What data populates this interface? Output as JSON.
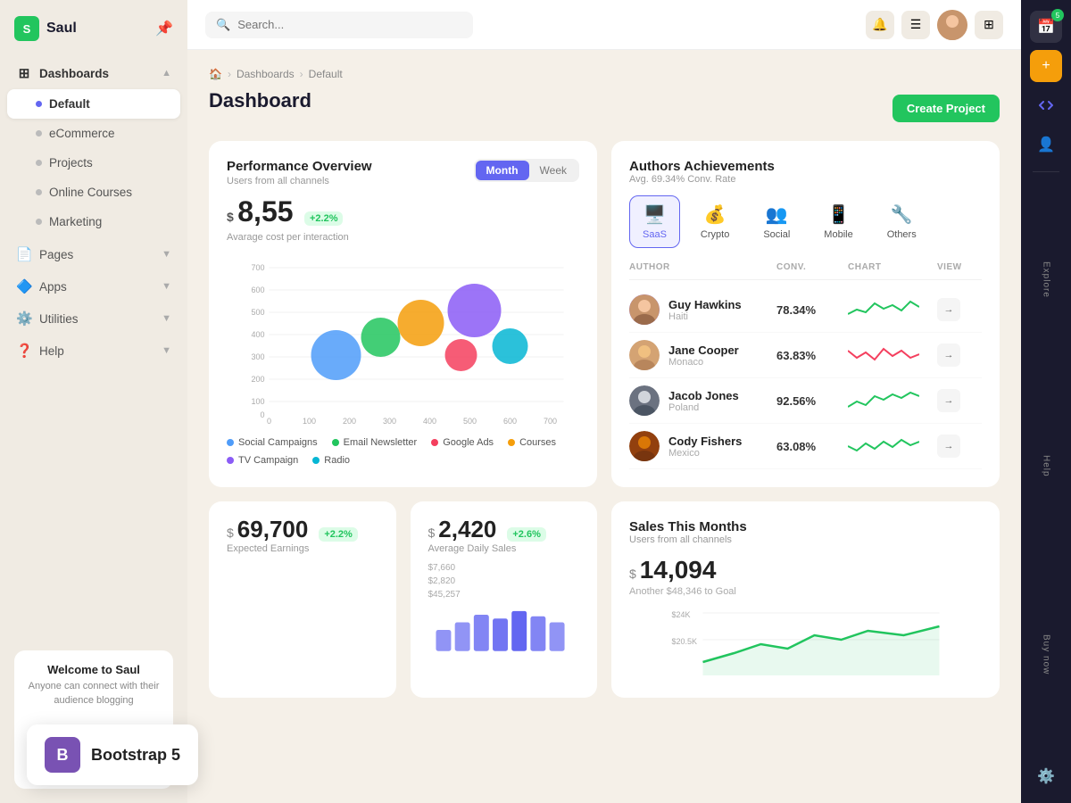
{
  "app": {
    "name": "Saul",
    "logo_letter": "S"
  },
  "sidebar": {
    "nav_items": [
      {
        "id": "dashboards",
        "label": "Dashboards",
        "icon": "⊞",
        "has_children": true,
        "active_group": true
      },
      {
        "id": "default",
        "label": "Default",
        "active": true,
        "is_child": true
      },
      {
        "id": "ecommerce",
        "label": "eCommerce",
        "is_child": true
      },
      {
        "id": "projects",
        "label": "Projects",
        "is_child": true
      },
      {
        "id": "online-courses",
        "label": "Online Courses",
        "is_child": true
      },
      {
        "id": "marketing",
        "label": "Marketing",
        "is_child": true
      },
      {
        "id": "pages",
        "label": "Pages",
        "icon": "📄",
        "has_children": true
      },
      {
        "id": "apps",
        "label": "Apps",
        "icon": "🔷",
        "has_children": true
      },
      {
        "id": "utilities",
        "label": "Utilities",
        "icon": "⚙️",
        "has_children": true
      },
      {
        "id": "help",
        "label": "Help",
        "icon": "❓",
        "has_children": true
      }
    ],
    "welcome": {
      "title": "Welcome to Saul",
      "subtitle": "Anyone can connect with their audience blogging"
    }
  },
  "topbar": {
    "search_placeholder": "Search..."
  },
  "breadcrumb": {
    "home": "🏠",
    "dashboards": "Dashboards",
    "current": "Default"
  },
  "page": {
    "title": "Dashboard"
  },
  "create_button": "Create Project",
  "performance": {
    "title": "Performance Overview",
    "subtitle": "Users from all channels",
    "metric_value": "8,55",
    "metric_currency": "$",
    "metric_change": "+2.2%",
    "metric_label": "Avarage cost per interaction",
    "tab_month": "Month",
    "tab_week": "Week",
    "chart_y_labels": [
      "700",
      "600",
      "500",
      "400",
      "300",
      "200",
      "100",
      "0"
    ],
    "chart_x_labels": [
      "0",
      "100",
      "200",
      "300",
      "400",
      "500",
      "600",
      "700"
    ],
    "legend": [
      {
        "label": "Social Campaigns",
        "color": "#4f9cf9"
      },
      {
        "label": "Email Newsletter",
        "color": "#22c55e"
      },
      {
        "label": "Google Ads",
        "color": "#f43f5e"
      },
      {
        "label": "Courses",
        "color": "#f59e0b"
      },
      {
        "label": "TV Campaign",
        "color": "#8b5cf6"
      },
      {
        "label": "Radio",
        "color": "#06b6d4"
      }
    ]
  },
  "authors": {
    "title": "Authors Achievements",
    "subtitle": "Avg. 69.34% Conv. Rate",
    "categories": [
      {
        "id": "saas",
        "label": "SaaS",
        "icon": "🖥️",
        "active": true
      },
      {
        "id": "crypto",
        "label": "Crypto",
        "icon": "💰"
      },
      {
        "id": "social",
        "label": "Social",
        "icon": "👥"
      },
      {
        "id": "mobile",
        "label": "Mobile",
        "icon": "📱"
      },
      {
        "id": "others",
        "label": "Others",
        "icon": "🔧"
      }
    ],
    "table_headers": {
      "author": "AUTHOR",
      "conv": "CONV.",
      "chart": "CHART",
      "view": "VIEW"
    },
    "rows": [
      {
        "name": "Guy Hawkins",
        "location": "Haiti",
        "conv": "78.34%",
        "chart_color": "#22c55e",
        "avatar_color": "#8b5cf6"
      },
      {
        "name": "Jane Cooper",
        "location": "Monaco",
        "conv": "63.83%",
        "chart_color": "#f43f5e",
        "avatar_color": "#f59e0b"
      },
      {
        "name": "Jacob Jones",
        "location": "Poland",
        "conv": "92.56%",
        "chart_color": "#22c55e",
        "avatar_color": "#6366f1"
      },
      {
        "name": "Cody Fishers",
        "location": "Mexico",
        "conv": "63.08%",
        "chart_color": "#22c55e",
        "avatar_color": "#a78bfa"
      }
    ]
  },
  "stats": [
    {
      "currency": "$",
      "value": "69,700",
      "change": "+2.2%",
      "label": "Expected Earnings"
    },
    {
      "currency": "$",
      "value": "2,420",
      "change": "+2.6%",
      "label": "Average Daily Sales"
    }
  ],
  "sales": {
    "title": "Sales This Months",
    "subtitle": "Users from all channels",
    "currency": "$",
    "value": "14,094",
    "note": "Another $48,346 to Goal",
    "y_labels": [
      "$24K",
      "$20.5K"
    ],
    "bar_values": [
      "$7,660",
      "$2,820",
      "$45,257"
    ]
  },
  "right_sidebar": {
    "icons": [
      {
        "id": "calendar",
        "symbol": "📅",
        "badge": "5"
      },
      {
        "id": "add",
        "symbol": "➕"
      },
      {
        "id": "code",
        "symbol": "</>"
      },
      {
        "id": "user",
        "symbol": "👤"
      },
      {
        "id": "settings",
        "symbol": "⚙️"
      }
    ],
    "labels": [
      "Explore",
      "Help",
      "Buy now"
    ]
  },
  "bootstrap": {
    "icon_letter": "B",
    "title": "Bootstrap 5"
  }
}
